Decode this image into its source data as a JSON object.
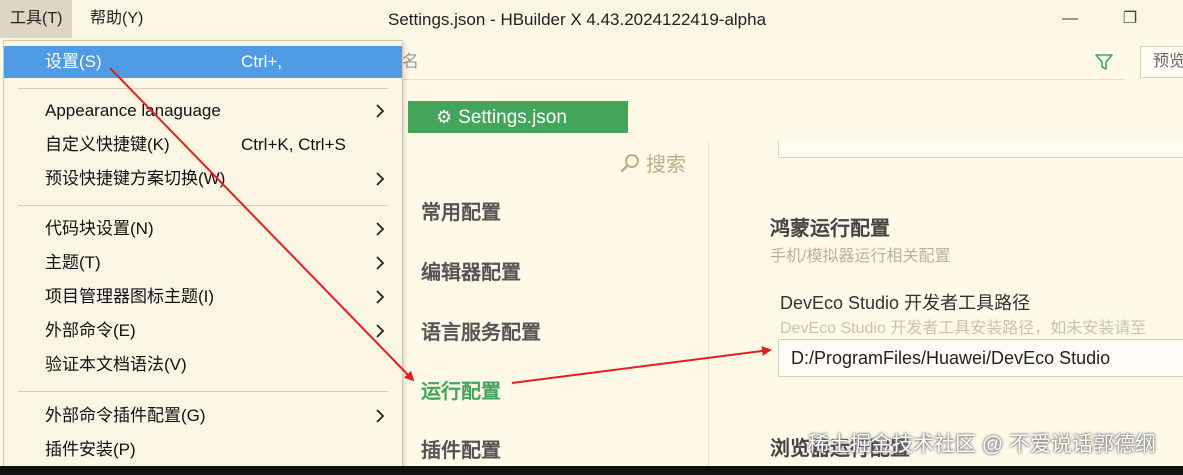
{
  "menubar": {
    "items": [
      {
        "label": "工具(T)"
      },
      {
        "label": "帮助(Y)"
      }
    ]
  },
  "window": {
    "title": "Settings.json - HBuilder X 4.43.2024122419-alpha",
    "minimize_glyph": "—",
    "maximize_glyph": "❐"
  },
  "search": {
    "text": "名",
    "filter_icon": "filter-icon",
    "preview_label": "预览"
  },
  "tab": {
    "label": "Settings.json",
    "icon": "gear-icon"
  },
  "sidebar": {
    "search_label": "搜索",
    "items": [
      {
        "label": "常用配置"
      },
      {
        "label": "编辑器配置"
      },
      {
        "label": "语言服务配置"
      },
      {
        "label": "运行配置",
        "active": true
      },
      {
        "label": "插件配置"
      }
    ]
  },
  "content": {
    "section_title": "鸿蒙运行配置",
    "section_subtitle": "手机/模拟器运行相关配置",
    "field_label": "DevEco Studio 开发者工具路径",
    "field_hint": "DevEco Studio 开发者工具安装路径，如未安装请至",
    "field_value": "D:/ProgramFiles/Huawei/DevEco Studio",
    "next_section_title": "浏览器运行配置",
    "watermark": "稀土掘金技术社区 @ 不爱说话郭德纲"
  },
  "dropdown": {
    "items": [
      {
        "label": "设置(S)",
        "shortcut": "Ctrl+,",
        "submenu": false,
        "highlight": true
      },
      {
        "label": "Appearance lanaguage",
        "shortcut": "",
        "submenu": true
      },
      {
        "label": "自定义快捷键(K)",
        "shortcut": "Ctrl+K, Ctrl+S",
        "submenu": false
      },
      {
        "label": "预设快捷键方案切换(W)",
        "shortcut": "",
        "submenu": true
      },
      {
        "label": "代码块设置(N)",
        "shortcut": "",
        "submenu": true
      },
      {
        "label": "主题(T)",
        "shortcut": "",
        "submenu": true
      },
      {
        "label": "项目管理器图标主题(I)",
        "shortcut": "",
        "submenu": true
      },
      {
        "label": "外部命令(E)",
        "shortcut": "",
        "submenu": true
      },
      {
        "label": "验证本文档语法(V)",
        "shortcut": "",
        "submenu": false
      },
      {
        "label": "外部命令插件配置(G)",
        "shortcut": "",
        "submenu": true
      },
      {
        "label": "插件安装(P)",
        "shortcut": "",
        "submenu": false
      }
    ]
  },
  "colors": {
    "accent_green": "#42a55a",
    "highlight_blue": "#4f9be6",
    "annotation_red": "#e02020",
    "background": "#fffae8"
  }
}
